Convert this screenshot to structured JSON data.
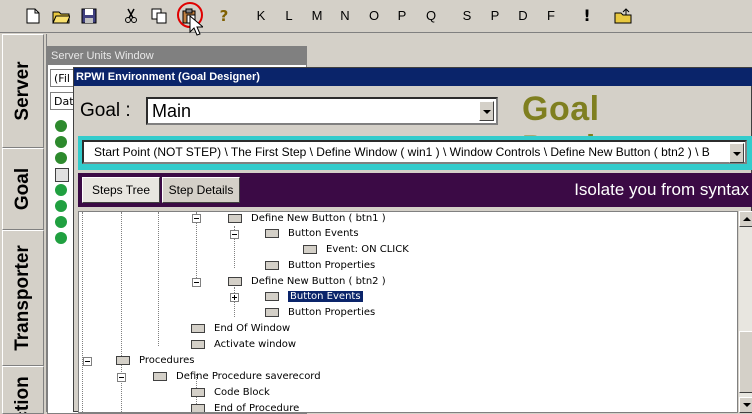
{
  "toolbar": {
    "letters": [
      "K",
      "L",
      "M",
      "N",
      "O",
      "P",
      "Q",
      "S",
      "P",
      "D",
      "F"
    ],
    "exclamation": "!",
    "question": "?"
  },
  "sidebar": {
    "tabs": [
      "Server",
      "Goal",
      "Transporter",
      "ction"
    ]
  },
  "server_window": {
    "title": "Server Units Window",
    "tab1": "(Fil",
    "tab2": "Dat"
  },
  "goal_window": {
    "title": "RPWI Environment (Goal Designer)",
    "goal_label": "Goal :",
    "goal_value": "Main",
    "brand_title": "Goal Designer",
    "path": "Start Point (NOT STEP)  \\  The First Step  \\  Define Window  ( win1 )  \\  Window Controls  \\  Define New Button ( btn2 )  \\  B",
    "tabs": [
      "Steps Tree",
      "Step Details"
    ],
    "tagline": "Isolate you from syntax"
  },
  "tree": {
    "nodes": [
      "Define New Button ( btn1 )",
      "Button Events",
      "Event: ON CLICK",
      "Button Properties",
      "Define New Button ( btn2 )",
      "Button Events",
      "Button Properties",
      "End Of Window",
      "Activate window",
      "Procedures",
      "Define Procedure saverecord",
      "Code Block",
      "End of Procedure"
    ]
  }
}
